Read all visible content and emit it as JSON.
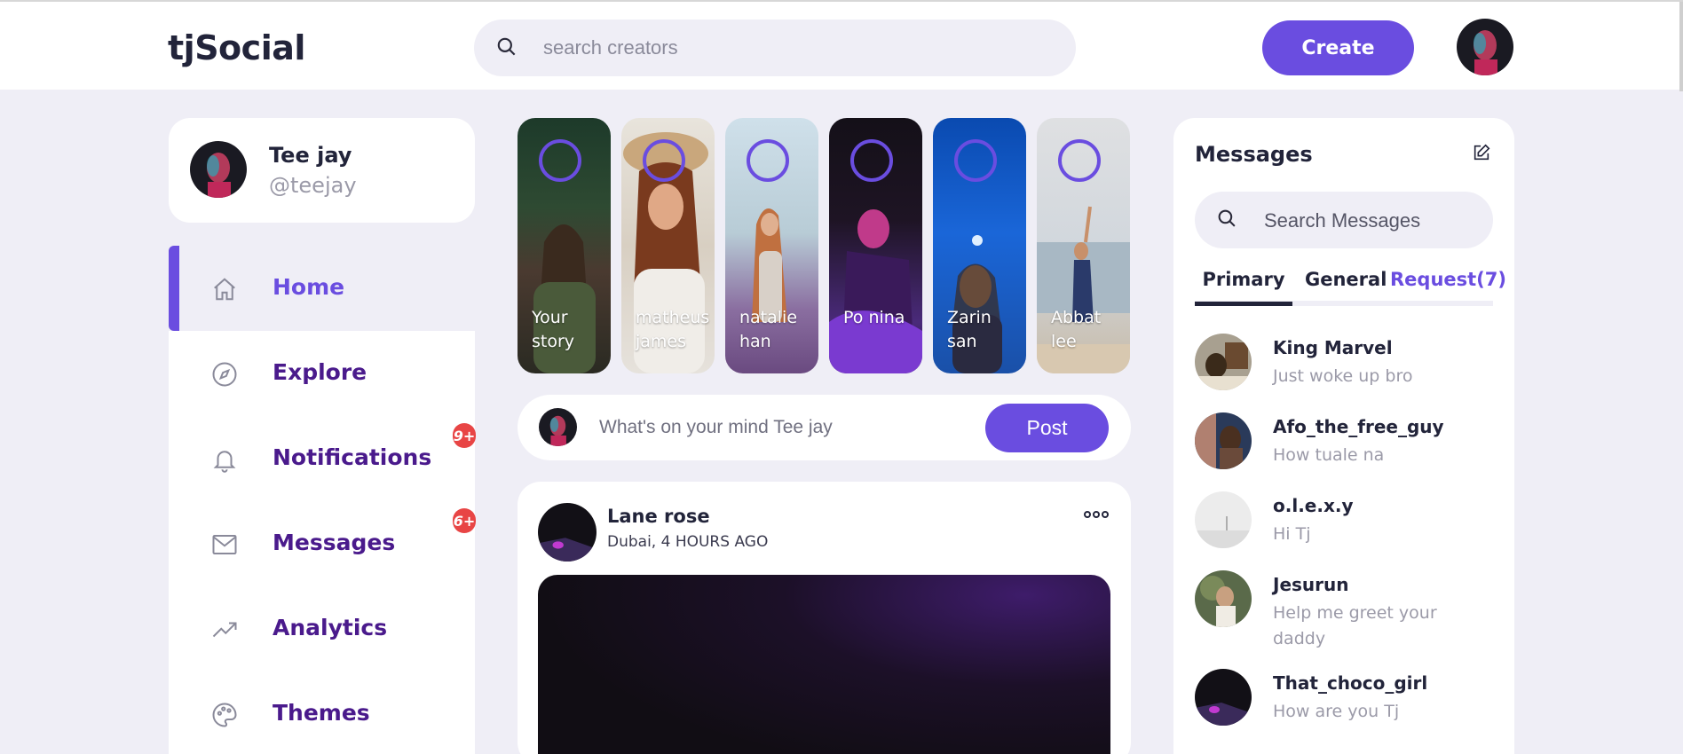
{
  "header": {
    "logo": "tjSocial",
    "search_placeholder": "search creators",
    "create_label": "Create"
  },
  "profile": {
    "name": "Tee jay",
    "handle": "@teejay"
  },
  "sidebar": {
    "items": [
      {
        "label": "Home",
        "icon": "home-icon",
        "active": true
      },
      {
        "label": "Explore",
        "icon": "compass-icon"
      },
      {
        "label": "Notifications",
        "icon": "bell-icon",
        "badge": "9+"
      },
      {
        "label": "Messages",
        "icon": "envelope-icon",
        "badge": "6+"
      },
      {
        "label": "Analytics",
        "icon": "trending-up-icon"
      },
      {
        "label": "Themes",
        "icon": "palette-icon"
      }
    ]
  },
  "stories": [
    {
      "name": "Your story"
    },
    {
      "name": "matheus james"
    },
    {
      "name": "natalie han"
    },
    {
      "name": "Po nina"
    },
    {
      "name": "Zarin san"
    },
    {
      "name": "Abbat lee"
    }
  ],
  "composer": {
    "placeholder": "What's on your mind Tee jay",
    "post_label": "Post"
  },
  "feed": {
    "author": "Lane rose",
    "meta": "Dubai, 4 HOURS AGO"
  },
  "messages": {
    "title": "Messages",
    "search_placeholder": "Search Messages",
    "tabs": [
      "Primary",
      "General",
      "Request(7)"
    ],
    "items": [
      {
        "name": "King Marvel",
        "text": "Just woke up bro"
      },
      {
        "name": "Afo_the_free_guy",
        "text": "How tuale na"
      },
      {
        "name": "o.l.e.x.y",
        "text": "Hi Tj"
      },
      {
        "name": "Jesurun",
        "text": "Help me greet your daddy"
      },
      {
        "name": "That_choco_girl",
        "text": "How are you Tj"
      }
    ]
  },
  "colors": {
    "accent": "#6a4de0",
    "nav_text": "#4a1a8c",
    "badge": "#e84545",
    "background": "#efeef6"
  }
}
